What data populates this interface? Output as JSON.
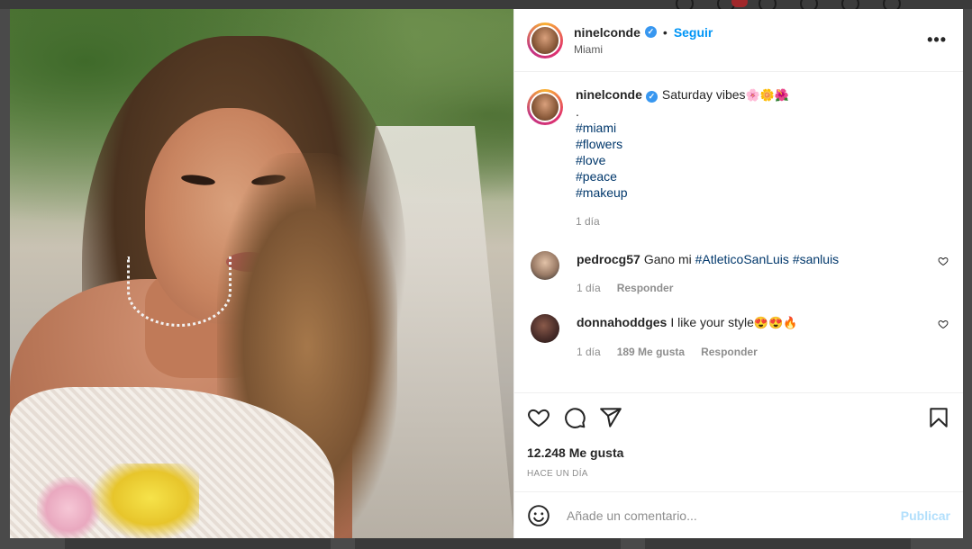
{
  "post": {
    "author": "ninelconde",
    "follow_label": "Seguir",
    "separator": "•",
    "location": "Miami",
    "more_label": "•••",
    "verified_mark": "✓"
  },
  "caption": {
    "author": "ninelconde",
    "text": "Saturday vibes",
    "emojis": "🌸🌼🌺",
    "dot_line": ".",
    "hashtags": [
      "#miami",
      "#flowers",
      "#love",
      "#peace",
      "#makeup"
    ],
    "time": "1 día"
  },
  "comments": [
    {
      "user": "pedrocg57",
      "text": "Gano mi",
      "hashtags": [
        "#AtleticoSanLuis",
        "#sanluis"
      ],
      "time": "1 día",
      "reply_label": "Responder"
    },
    {
      "user": "donnahoddges",
      "text": "I like your style",
      "emojis": "😍😍🔥",
      "time": "1 día",
      "likes": "189 Me gusta",
      "reply_label": "Responder"
    }
  ],
  "actions": {
    "likes": "12.248 Me gusta",
    "timestamp": "HACE UN DÍA"
  },
  "add_comment": {
    "placeholder": "Añade un comentario...",
    "publish_label": "Publicar"
  },
  "icons": {
    "like": "heart-icon",
    "comment": "comment-icon",
    "share": "share-icon",
    "save": "bookmark-icon",
    "emoji": "emoji-icon",
    "more": "more-icon",
    "verified": "verified-badge-icon"
  },
  "colors": {
    "accent": "#0095f6",
    "publish_disabled": "#b2dffc",
    "hashtag": "#00376b",
    "muted": "#8e8e8e",
    "verified": "#3897f0"
  }
}
